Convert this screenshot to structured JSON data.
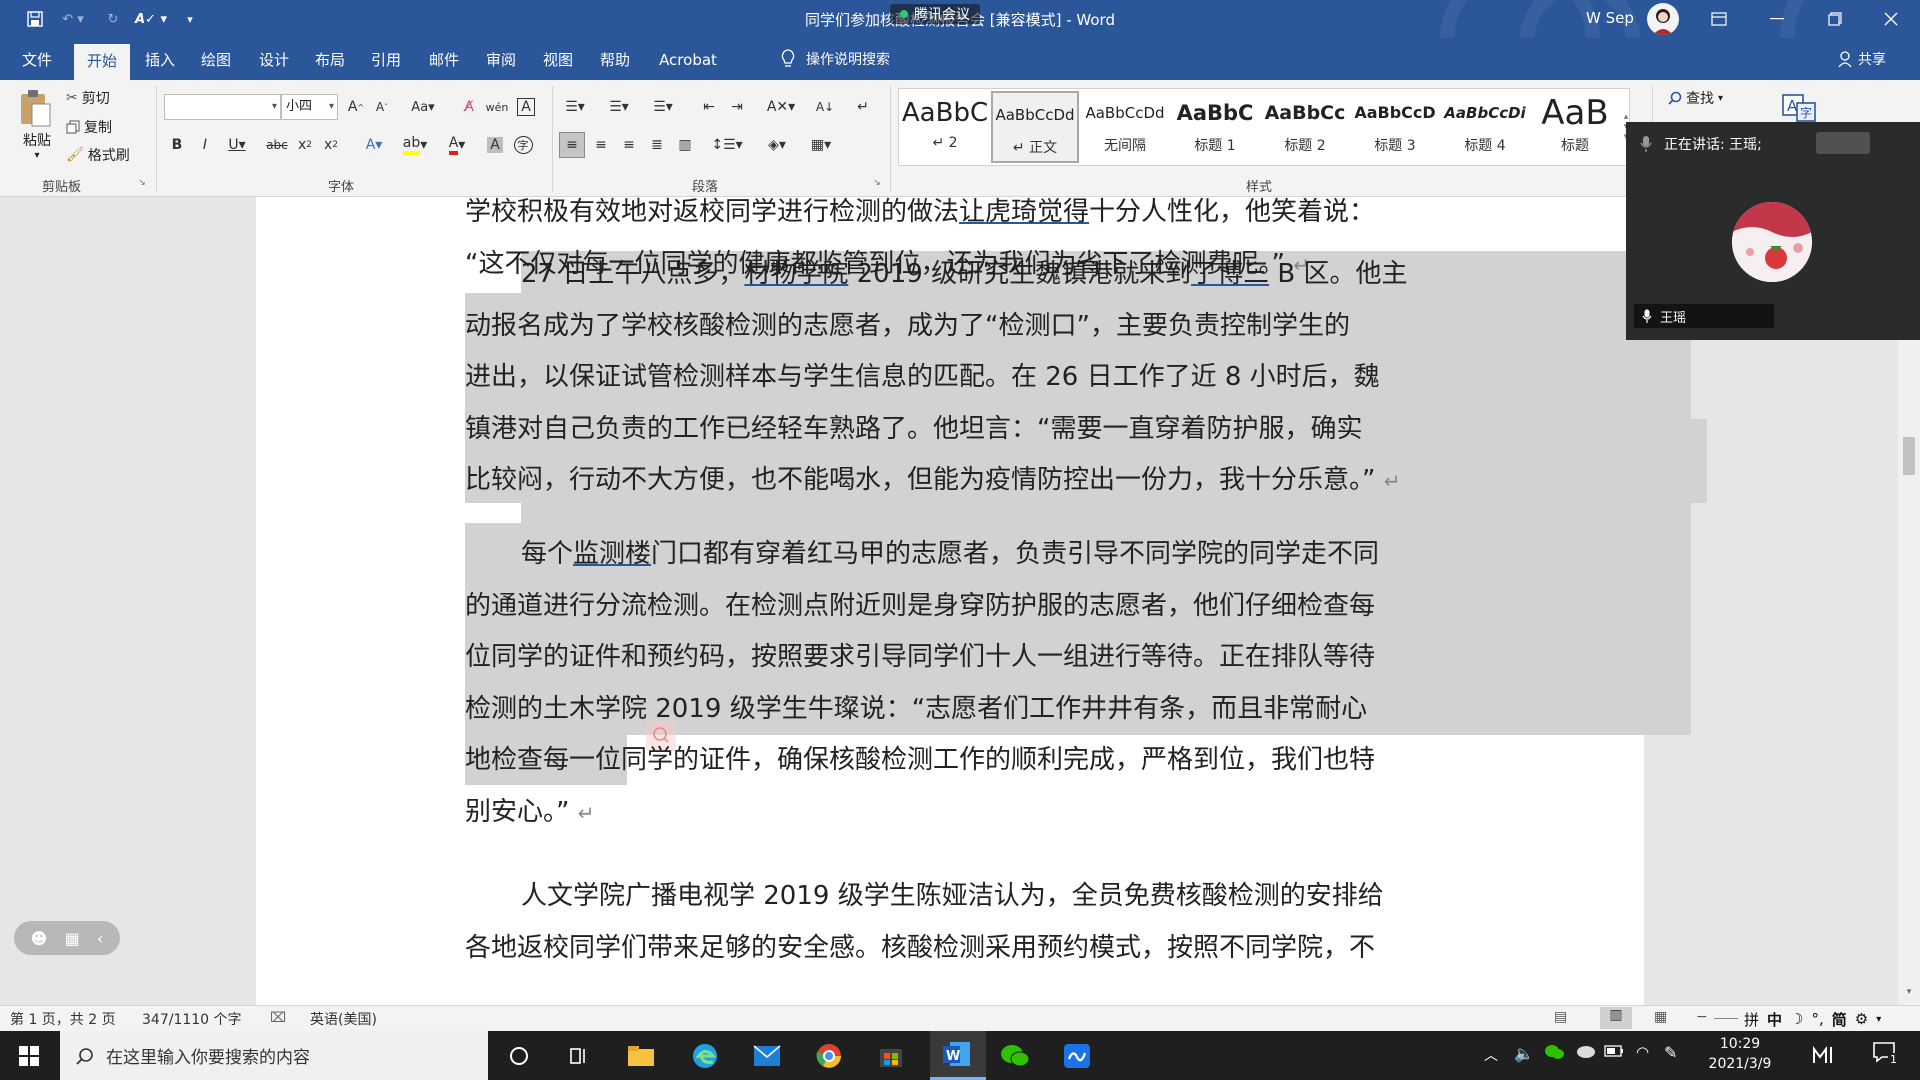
{
  "window": {
    "title": "同学们参加核酸检测报告会 [兼容模式] - Word",
    "user_name": "W Sep",
    "meeting_banner": "腾讯会议"
  },
  "menu": {
    "tabs": [
      "文件",
      "开始",
      "插入",
      "绘图",
      "设计",
      "布局",
      "引用",
      "邮件",
      "审阅",
      "视图",
      "帮助",
      "Acrobat"
    ],
    "active_tab": "开始",
    "tell_me": "操作说明搜索",
    "share": "共享"
  },
  "ribbon": {
    "clipboard": {
      "label": "剪贴板",
      "paste": "粘贴",
      "cut": "剪切",
      "copy": "复制",
      "format_painter": "格式刷"
    },
    "font": {
      "label": "字体",
      "font_name": "",
      "font_size": "小四"
    },
    "paragraph": {
      "label": "段落"
    },
    "styles": {
      "label": "样式",
      "items": [
        {
          "preview": "AaBbC",
          "name": "↵ 2"
        },
        {
          "preview": "AaBbCcDd",
          "name": "↵ 正文"
        },
        {
          "preview": "AaBbCcDd",
          "name": "无间隔"
        },
        {
          "preview": "AaBbC",
          "name": "标题 1"
        },
        {
          "preview": "AaBbCc",
          "name": "标题 2"
        },
        {
          "preview": "AaBbCcD",
          "name": "标题 3"
        },
        {
          "preview": "AaBbCcDi",
          "name": "标题 4"
        },
        {
          "preview": "AaB",
          "name": "标题"
        }
      ]
    },
    "editing": {
      "find": "查找"
    }
  },
  "meeting": {
    "speaking": "正在讲话: 王瑶;",
    "participant": "王瑶"
  },
  "document": {
    "p1_line1_a": "学校积极有效地对返校同学进行检测的做法",
    "p1_line1_u": "让虎琦觉得",
    "p1_line1_b": "十分人性化，他笑着说：",
    "p1_line2": "“这不仅对每一位同学的健康都监管到位，还为我们为省下了检测费呢。”",
    "p2_line1_a": "27 日上午八点多，",
    "p2_line1_u1": "材物学院",
    "p2_line1_b": " 2019 级研究生魏镇港就来到",
    "p2_line1_u2": "了博三",
    "p2_line1_c": " B 区。他主",
    "p2_line2": "动报名成为了学校核酸检测的志愿者，成为了“检测口”，主要负责控制学生的",
    "p2_line3": "进出，以保证试管检测样本与学生信息的匹配。在 26 日工作了近 8 小时后，魏",
    "p2_line4": "镇港对自己负责的工作已经轻车熟路了。他坦言：“需要一直穿着防护服，确实",
    "p2_line5": "比较闷，行动不大方便，也不能喝水，但能为疫情防控出一份力，我十分乐意。”",
    "p3_line1_a": "每个",
    "p3_line1_u": "监测楼",
    "p3_line1_b": "门口都有穿着红马甲的志愿者，负责引导不同学院的同学走不同",
    "p3_line2": "的通道进行分流检测。在检测点附近则是身穿防护服的志愿者，他们仔细检查每",
    "p3_line3": "位同学的证件和预约码，按照要求引导同学们十人一组进行等待。正在排队等待",
    "p3_line4": "检测的土木学院 2019 级学生牛璨说：“志愿者们工作井井有条，而且非常耐心",
    "p3_line5": "地检查每一位同学的证件，确保核酸检测工作的顺利完成，严格到位，我们也特",
    "p3_line6": "别安心。”",
    "p4_line1": "人文学院广播电视学 2019 级学生陈娅洁认为，全员免费核酸检测的安排给",
    "p4_line2": "各地返校同学们带来足够的安全感。核酸检测采用预约模式，按照不同学院，不"
  },
  "status": {
    "page": "第 1 页，共 2 页",
    "words": "347/1110 个字",
    "language": "英语(美国)"
  },
  "taskbar": {
    "search_placeholder": "在这里输入你要搜索的内容",
    "time": "10:29",
    "date": "2021/3/9",
    "ime_mode": "中",
    "ime_script": "简",
    "notification_count": "1"
  },
  "colors": {
    "word_blue": "#2b579a",
    "selection": "#d2d2d2"
  }
}
